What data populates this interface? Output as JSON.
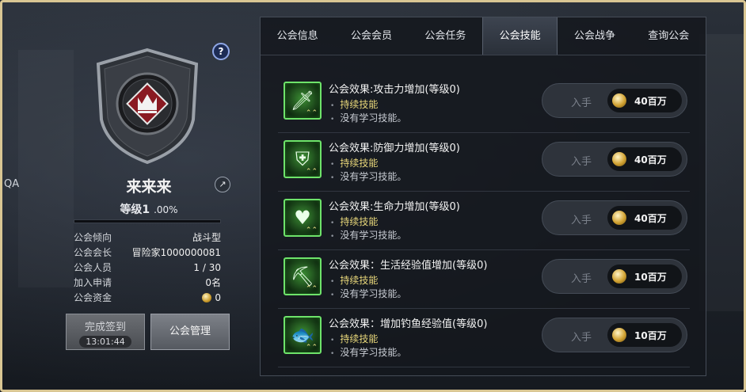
{
  "edge_text": "QA",
  "guild": {
    "name": "来来来",
    "level_label": "等级1",
    "level_pct": ".00%",
    "progress": 0.0,
    "info": [
      {
        "key": "公会倾向",
        "value": "战斗型"
      },
      {
        "key": "公会会长",
        "value": "冒险家1000000081"
      },
      {
        "key": "公会人员",
        "value": "1 / 30"
      },
      {
        "key": "加入申请",
        "value": "0名"
      },
      {
        "key": "公会资金",
        "value": "0",
        "icon": "coin-icon"
      }
    ],
    "checkin_label": "完成签到",
    "checkin_timer": "13:01:44",
    "manage_label": "公会管理",
    "help_glyph": "?",
    "share_glyph": "↗"
  },
  "tabs": [
    {
      "label": "公会信息",
      "active": false
    },
    {
      "label": "公会会员",
      "active": false
    },
    {
      "label": "公会任务",
      "active": false
    },
    {
      "label": "公会技能",
      "active": true
    },
    {
      "label": "公会战争",
      "active": false
    },
    {
      "label": "查询公会",
      "active": false
    }
  ],
  "skills": [
    {
      "title": "公会效果:攻击力增加(等级0)",
      "type": "持续技能",
      "status": "没有学习技能。",
      "buy_label": "入手",
      "price": "40百万",
      "icon": "sword-icon",
      "glyph": "🗡"
    },
    {
      "title": "公会效果:防御力增加(等级0)",
      "type": "持续技能",
      "status": "没有学习技能。",
      "buy_label": "入手",
      "price": "40百万",
      "icon": "shield-icon",
      "glyph": "⛨"
    },
    {
      "title": "公会效果:生命力增加(等级0)",
      "type": "持续技能",
      "status": "没有学习技能。",
      "buy_label": "入手",
      "price": "40百万",
      "icon": "heart-plus-icon",
      "glyph": "♥"
    },
    {
      "title": "公会效果：生活经验值增加(等级0)",
      "type": "持续技能",
      "status": "没有学习技能。",
      "buy_label": "入手",
      "price": "10百万",
      "icon": "pickaxe-icon",
      "glyph": "⛏"
    },
    {
      "title": "公会效果：增加钓鱼经验值(等级0)",
      "type": "持续技能",
      "status": "没有学习技能。",
      "buy_label": "入手",
      "price": "10百万",
      "icon": "fish-icon",
      "glyph": "🐟"
    }
  ]
}
